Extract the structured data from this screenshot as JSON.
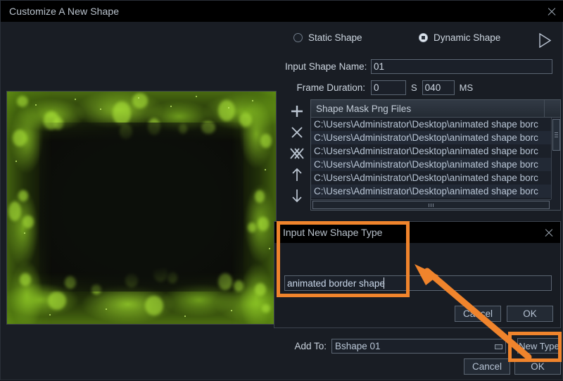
{
  "window": {
    "title": "Customize A New Shape",
    "close_icon": "close-icon"
  },
  "shape_type": {
    "static_label": "Static Shape",
    "dynamic_label": "Dynamic Shape",
    "selected": "Dynamic Shape",
    "preview_icon": "play-triangle-icon"
  },
  "form": {
    "name_label": "Input Shape Name:",
    "name_value": "01",
    "duration_label": "Frame Duration:",
    "seconds_value": "0",
    "seconds_unit": "S",
    "ms_value": "040",
    "ms_unit": "MS"
  },
  "list": {
    "header": "Shape Mask Png Files",
    "rows": [
      "C:\\Users\\Administrator\\Desktop\\animated shape borc",
      "C:\\Users\\Administrator\\Desktop\\animated shape borc",
      "C:\\Users\\Administrator\\Desktop\\animated shape borc",
      "C:\\Users\\Administrator\\Desktop\\animated shape borc",
      "C:\\Users\\Administrator\\Desktop\\animated shape borc",
      "C:\\Users\\Administrator\\Desktop\\animated shape borc"
    ],
    "tools": [
      {
        "name": "add-file-icon",
        "glyph": "plus"
      },
      {
        "name": "remove-file-icon",
        "glyph": "cross"
      },
      {
        "name": "remove-all-files-icon",
        "glyph": "double-cross"
      },
      {
        "name": "move-up-icon",
        "glyph": "arrow-up"
      },
      {
        "name": "move-down-icon",
        "glyph": "arrow-down"
      }
    ]
  },
  "bottom": {
    "add_to_label": "Add To:",
    "add_to_value": "Bshape 01",
    "new_type_label": "New Type",
    "cancel_label": "Cancel",
    "ok_label": "OK"
  },
  "modal": {
    "title": "Input New Shape Type",
    "input_value": "animated border shape",
    "cancel_label": "Cancel",
    "ok_label": "OK",
    "close_icon": "close-icon"
  },
  "annotation": {
    "color": "#f0842c",
    "highlights": [
      "input-new-shape-type-dialog",
      "new-type-button"
    ],
    "arrow": "points from New Type button to the shape type input"
  },
  "preview": {
    "description": "green animated bokeh particle border on dark background",
    "accent": "#96d228"
  }
}
